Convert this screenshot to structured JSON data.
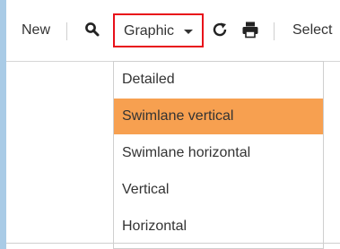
{
  "toolbar": {
    "new_label": "New",
    "search_icon": "magnifier-icon",
    "graphic_label": "Graphic",
    "refresh_icon": "refresh-icon",
    "print_icon": "printer-icon",
    "select_label": "Select"
  },
  "dropdown": {
    "items": [
      {
        "label": "Detailed"
      },
      {
        "label": "Swimlane vertical"
      },
      {
        "label": "Swimlane horizontal"
      },
      {
        "label": "Vertical"
      },
      {
        "label": "Horizontal"
      }
    ],
    "active_index": 1,
    "active_color": "#f7a050"
  },
  "colors": {
    "highlight_border": "#e8101a",
    "background": "#a9cbe6"
  }
}
